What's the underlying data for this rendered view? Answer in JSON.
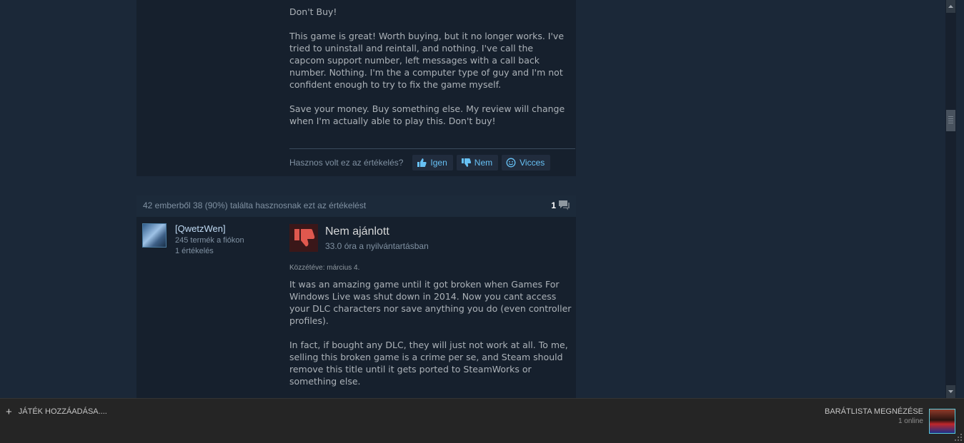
{
  "review1": {
    "paragraphs": [
      "Don't Buy!",
      "This game is great! Worth buying, but it no longer works. I've tried to uninstall and reintall, and nothing. I've call the capcom support number, left messages with a call back number. Nothing. I'm the a computer type of guy and I'm not confident enough to try to fix the game myself.",
      "Save your money. Buy something else. My review will change when I'm actually able to play this. Don't buy!"
    ],
    "helpful_question": "Hasznos volt ez az értékelés?",
    "vote_yes": "Igen",
    "vote_no": "Nem",
    "vote_funny": "Vicces"
  },
  "review2": {
    "helpful_summary": "42 emberből 38 (90%) találta hasznosnak ezt az értékelést",
    "comment_count": "1",
    "username": "[QwetzWen]",
    "products": "245 termék a fiókon",
    "reviews": "1 értékelés",
    "verdict": "Nem ajánlott",
    "hours": "33.0 óra a nyilvántartásban",
    "posted": "Közzétéve: március 4.",
    "paragraphs": [
      "It was an amazing game until it got broken when Games For Windows Live was shut down in 2014. Now you cant access your DLC characters nor save anything you do (even controller profiles).",
      "In fact, if bought any DLC, they will just not work at all. To me, selling this broken game is a crime per se, and Steam should remove this title until it gets ported to SteamWorks or something else."
    ]
  },
  "footer": {
    "add_game": "JÁTÉK HOZZÁADÁSA....",
    "friends_list": "BARÁTLISTA MEGNÉZÉSE",
    "online": "1 online"
  },
  "colors": {
    "page_bg": "#1b2838",
    "review_bg": "#16202d",
    "link": "#67c1f5",
    "thumbs_down": "#e0584e",
    "footer_bg": "#252525"
  },
  "icons": [
    "thumbs-up-icon",
    "thumbs-down-icon",
    "smiley-icon",
    "comment-bubble-icon",
    "plus-icon",
    "scroll-up-icon",
    "scroll-down-icon"
  ]
}
